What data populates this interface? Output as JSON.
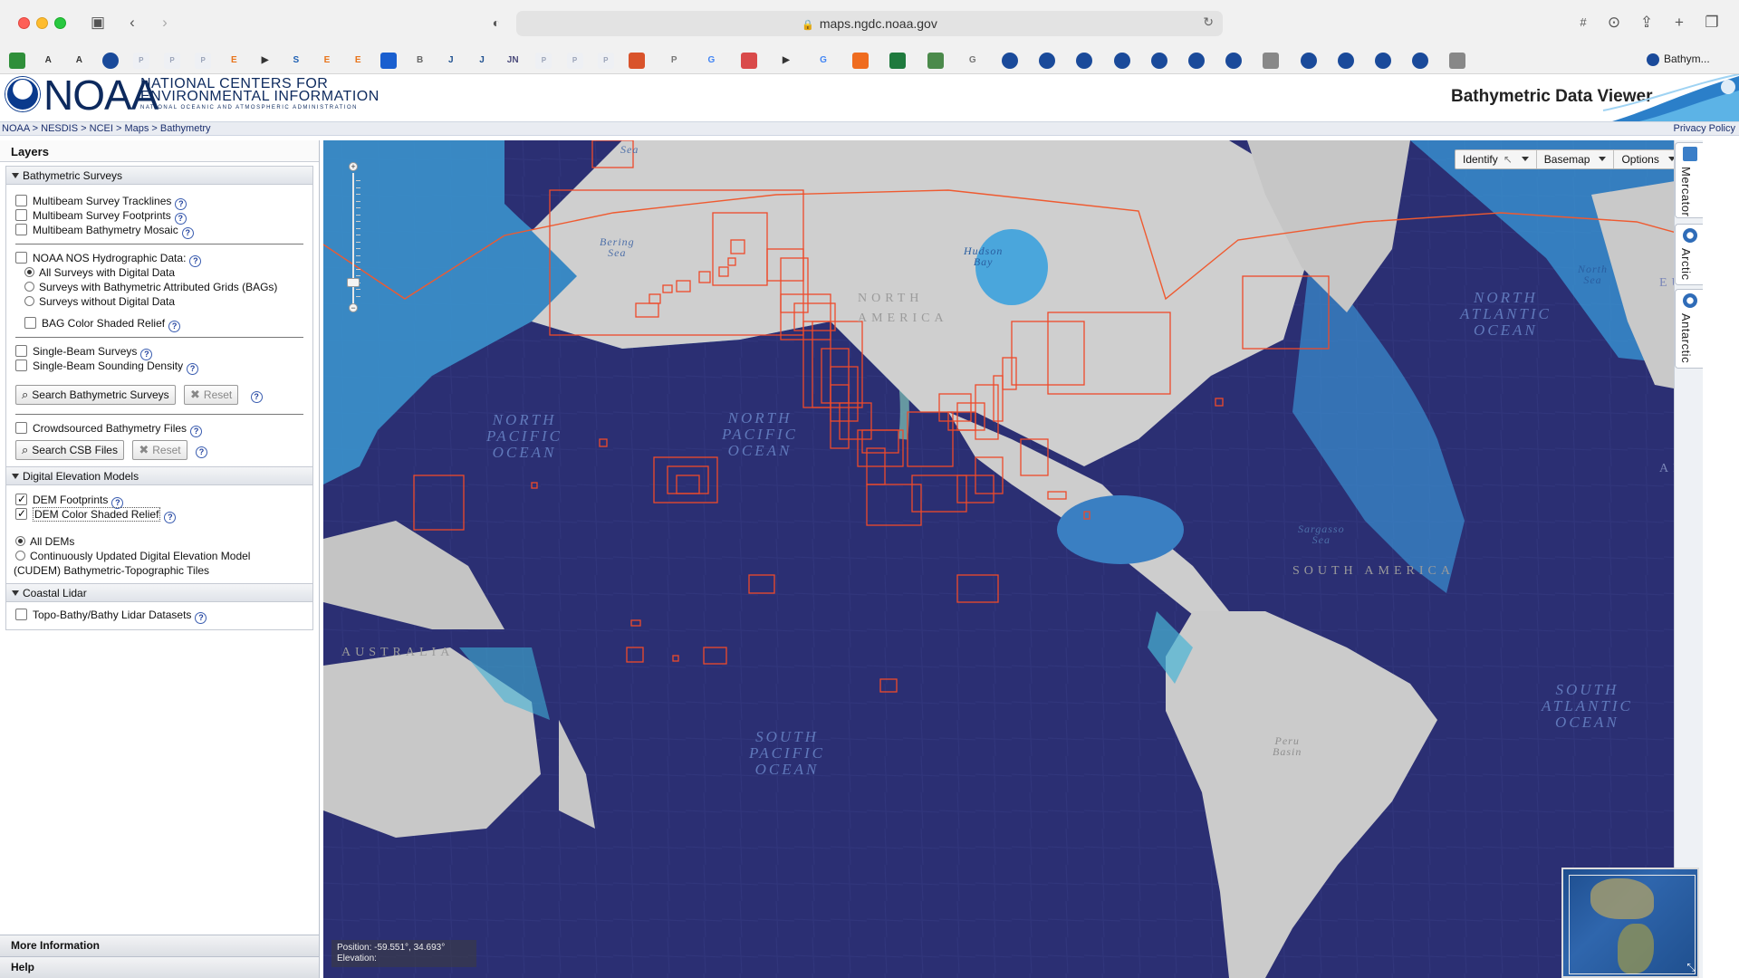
{
  "browser": {
    "url": "maps.ngdc.noaa.gov",
    "active_tab_label": "Bathym...",
    "bookmarks": [
      {
        "icon": "drive-icon",
        "color": "#2f8f3a",
        "text": ""
      },
      {
        "icon": "a-icon",
        "color": "#333333",
        "text": "A"
      },
      {
        "icon": "a-icon",
        "color": "#333333",
        "text": "A"
      },
      {
        "icon": "noaa-icon",
        "color": "#1a4a9a",
        "text": ""
      },
      {
        "icon": "pdf-icon",
        "color": "#c7cdd8",
        "text": "P"
      },
      {
        "icon": "pdf-icon",
        "color": "#c7cdd8",
        "text": "P"
      },
      {
        "icon": "pdf-icon",
        "color": "#c7cdd8",
        "text": "P"
      },
      {
        "icon": "e-icon",
        "color": "#e8741b",
        "text": "E"
      },
      {
        "icon": "arrow-icon",
        "color": "#333333",
        "text": "▶"
      },
      {
        "icon": "s-icon",
        "color": "#1d5fb3",
        "text": "S"
      },
      {
        "icon": "e-icon",
        "color": "#e8741b",
        "text": "E"
      },
      {
        "icon": "e-icon",
        "color": "#e8741b",
        "text": "E"
      },
      {
        "icon": "cap-icon",
        "color": "#1a5fcf",
        "text": ""
      },
      {
        "icon": "b-icon",
        "color": "#666666",
        "text": "B"
      },
      {
        "icon": "jbc-icon",
        "color": "#1d4f8f",
        "text": "J"
      },
      {
        "icon": "jbc-icon",
        "color": "#1d4f8f",
        "text": "J"
      },
      {
        "icon": "jn-icon",
        "color": "#4a4a7a",
        "text": "JN"
      },
      {
        "icon": "pdf-icon",
        "color": "#c7cdd8",
        "text": "P"
      },
      {
        "icon": "pdf-icon",
        "color": "#c7cdd8",
        "text": "P"
      },
      {
        "icon": "pdf-icon",
        "color": "#c7cdd8",
        "text": "P"
      },
      {
        "icon": "eye-icon",
        "color": "#d9532b",
        "text": ""
      },
      {
        "icon": "p-icon",
        "color": "#777777",
        "text": "P"
      },
      {
        "icon": "google-icon",
        "color": "#4285f4",
        "text": "G"
      },
      {
        "icon": "circle-icon",
        "color": "#d94a4a",
        "text": ""
      },
      {
        "icon": "arrow-icon",
        "color": "#333333",
        "text": "▶"
      },
      {
        "icon": "google-icon",
        "color": "#4285f4",
        "text": "G"
      },
      {
        "icon": "cube-icon",
        "color": "#ef6c1f",
        "text": ""
      },
      {
        "icon": "sheet-icon",
        "color": "#1f7a3e",
        "text": ""
      },
      {
        "icon": "doc-icon",
        "color": "#4b8a4b",
        "text": ""
      },
      {
        "icon": "g-icon",
        "color": "#777777",
        "text": "G"
      },
      {
        "icon": "noaa-icon",
        "color": "#1a4a9a",
        "text": ""
      },
      {
        "icon": "noaa-icon",
        "color": "#1a4a9a",
        "text": ""
      },
      {
        "icon": "noaa-icon",
        "color": "#1a4a9a",
        "text": ""
      },
      {
        "icon": "noaa-icon",
        "color": "#1a4a9a",
        "text": ""
      },
      {
        "icon": "noaa-icon",
        "color": "#1a4a9a",
        "text": ""
      },
      {
        "icon": "noaa-icon",
        "color": "#1a4a9a",
        "text": ""
      },
      {
        "icon": "noaa-icon",
        "color": "#1a4a9a",
        "text": ""
      },
      {
        "icon": "compass-icon",
        "color": "#888888",
        "text": ""
      },
      {
        "icon": "noaa-icon",
        "color": "#1a4a9a",
        "text": ""
      },
      {
        "icon": "noaa-icon",
        "color": "#1a4a9a",
        "text": ""
      },
      {
        "icon": "noaa-icon",
        "color": "#1a4a9a",
        "text": ""
      },
      {
        "icon": "noaa-icon",
        "color": "#1a4a9a",
        "text": ""
      },
      {
        "icon": "compass-icon",
        "color": "#888888",
        "text": ""
      }
    ]
  },
  "header": {
    "logo_text": "NOAA",
    "center_name_line1": "NATIONAL CENTERS FOR",
    "center_name_line2": "ENVIRONMENTAL INFORMATION",
    "center_sub": "NATIONAL OCEANIC AND ATMOSPHERIC ADMINISTRATION",
    "app_title": "Bathymetric Data Viewer"
  },
  "breadcrumb": {
    "items": [
      "NOAA",
      "NESDIS",
      "NCEI",
      "Maps",
      "Bathymetry"
    ],
    "separator": " > ",
    "privacy": "Privacy Policy"
  },
  "layers": {
    "title": "Layers",
    "bathymetric": {
      "header": "Bathymetric Surveys",
      "multibeam_tracklines": "Multibeam Survey Tracklines",
      "multibeam_footprints": "Multibeam Survey Footprints",
      "multibeam_mosaic": "Multibeam Bathymetry Mosaic",
      "nos_label": "NOAA NOS Hydrographic Data:",
      "nos_opt1": "All Surveys with Digital Data",
      "nos_opt2": "Surveys with Bathymetric Attributed Grids (BAGs)",
      "nos_opt3": "Surveys without Digital Data",
      "bag_relief": "BAG Color Shaded Relief",
      "single_beam": "Single-Beam Surveys",
      "single_beam_density": "Single-Beam Sounding Density",
      "search_btn": "Search Bathymetric Surveys",
      "reset_btn": "Reset",
      "crowdsourced": "Crowdsourced Bathymetry Files",
      "search_csb_btn": "Search CSB Files",
      "reset_csb_btn": "Reset"
    },
    "dem": {
      "header": "Digital Elevation Models",
      "footprints": "DEM Footprints",
      "relief": "DEM Color Shaded Relief",
      "all_dems": "All DEMs",
      "cudem_line1": "Continuously Updated Digital Elevation Model",
      "cudem_line2": "(CUDEM) Bathymetric-Topographic Tiles"
    },
    "lidar": {
      "header": "Coastal Lidar",
      "datasets": "Topo-Bathy/Bathy Lidar Datasets"
    },
    "more_info": "More Information",
    "help": "Help"
  },
  "map": {
    "toolbar": {
      "identify": "Identify",
      "basemap": "Basemap",
      "options": "Options"
    },
    "projections": [
      "Mercator",
      "Arctic",
      "Antarctic"
    ],
    "position_label": "Position: -59.551°, 34.693°",
    "elevation_label": "Elevation:",
    "labels": {
      "npo1": "NORTH\nPACIFIC\nOCEAN",
      "npo2": "NORTH\nPACIFIC\nOCEAN",
      "spo": "SOUTH\nPACIFIC\nOCEAN",
      "nao": "NORTH\nATLANTIC\nOCEAN",
      "sao": "SOUTH\nATLANTIC\nOCEAN",
      "n_america": "NORTH\nAMERICA",
      "s_america": "SOUTH AMERICA",
      "australia": "AUSTRALIA",
      "bering": "Bering\nSea",
      "hudson": "Hudson\nBay",
      "north_sea": "North\nSea",
      "sargasso": "Sargasso\nSea",
      "peru": "Peru\nBasin",
      "sea": "Sea",
      "euro": "EURO",
      "afric": "AFRIC"
    },
    "colors": {
      "deep_ocean": "#2b2f73",
      "shelf": "#3aa0d8",
      "land": "#c9c9c9",
      "footprint": "#e8452a"
    }
  }
}
